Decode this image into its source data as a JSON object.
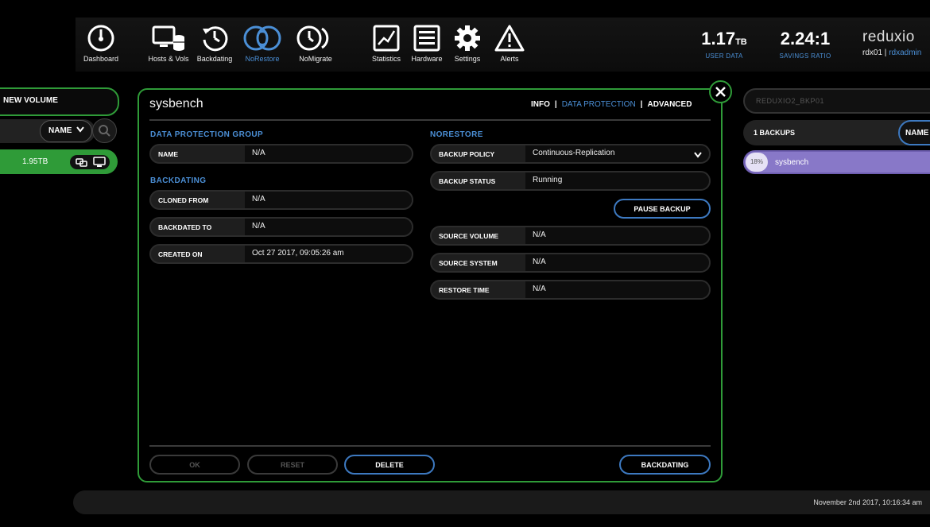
{
  "nav": {
    "items": [
      {
        "label": "Dashboard",
        "icon": "dashboard-gauge-icon"
      },
      {
        "label": "Hosts & Vols",
        "icon": "hosts-vols-icon"
      },
      {
        "label": "Backdating",
        "icon": "backdating-clock-icon"
      },
      {
        "label": "NoRestore",
        "icon": "norestore-sync-icon",
        "active": true
      },
      {
        "label": "NoMigrate",
        "icon": "nomigrate-icon"
      },
      {
        "label": "Statistics",
        "icon": "statistics-chart-icon"
      },
      {
        "label": "Hardware",
        "icon": "hardware-icon"
      },
      {
        "label": "Settings",
        "icon": "gear-icon"
      },
      {
        "label": "Alerts",
        "icon": "alert-triangle-icon"
      }
    ]
  },
  "stats": {
    "user_data": {
      "value": "1.17",
      "unit": "TB",
      "label": "USER DATA"
    },
    "savings": {
      "value": "2.24:1",
      "label": "SAVINGS RATIO"
    }
  },
  "brand": {
    "name": "reduxio",
    "host": "rdx01",
    "separator": "|",
    "user": "rdxadmin"
  },
  "left": {
    "header": "NEW VOLUME",
    "sort_label": "NAME",
    "volume": {
      "size": "1.95TB"
    }
  },
  "modal": {
    "title": "sysbench",
    "tabs": {
      "info": "INFO",
      "data_protection": "DATA PROTECTION",
      "advanced": "ADVANCED",
      "sep": "|"
    },
    "left_col": {
      "dpg_section": "DATA PROTECTION GROUP",
      "name": {
        "label": "NAME",
        "value": "N/A"
      },
      "backdating_section": "BACKDATING",
      "cloned_from": {
        "label": "CLONED FROM",
        "value": "N/A"
      },
      "backdated_to": {
        "label": "BACKDATED TO",
        "value": "N/A"
      },
      "created_on": {
        "label": "CREATED ON",
        "value": "Oct 27 2017, 09:05:26 am"
      }
    },
    "right_col": {
      "section": "NORESTORE",
      "backup_policy": {
        "label": "BACKUP POLICY",
        "value": "Continuous-Replication"
      },
      "backup_status": {
        "label": "BACKUP STATUS",
        "value": "Running"
      },
      "pause_label": "PAUSE BACKUP",
      "source_volume": {
        "label": "SOURCE VOLUME",
        "value": "N/A"
      },
      "source_system": {
        "label": "SOURCE SYSTEM",
        "value": "N/A"
      },
      "restore_time": {
        "label": "RESTORE TIME",
        "value": "N/A"
      }
    },
    "footer": {
      "ok": "OK",
      "reset": "RESET",
      "delete": "DELETE",
      "backdating": "BACKDATING"
    }
  },
  "right": {
    "search_placeholder": "REDUXIO2_BKP01",
    "backups_count": "1 BACKUPS",
    "sort_label": "NAME",
    "backup": {
      "percent": "18%",
      "name": "sysbench",
      "progress": 0.18
    }
  },
  "footer": {
    "datetime": "November 2nd 2017, 10:16:34 am"
  },
  "colors": {
    "accent_blue": "#4b8fd6",
    "green": "#2f9b38",
    "purple": "#8878c8"
  }
}
